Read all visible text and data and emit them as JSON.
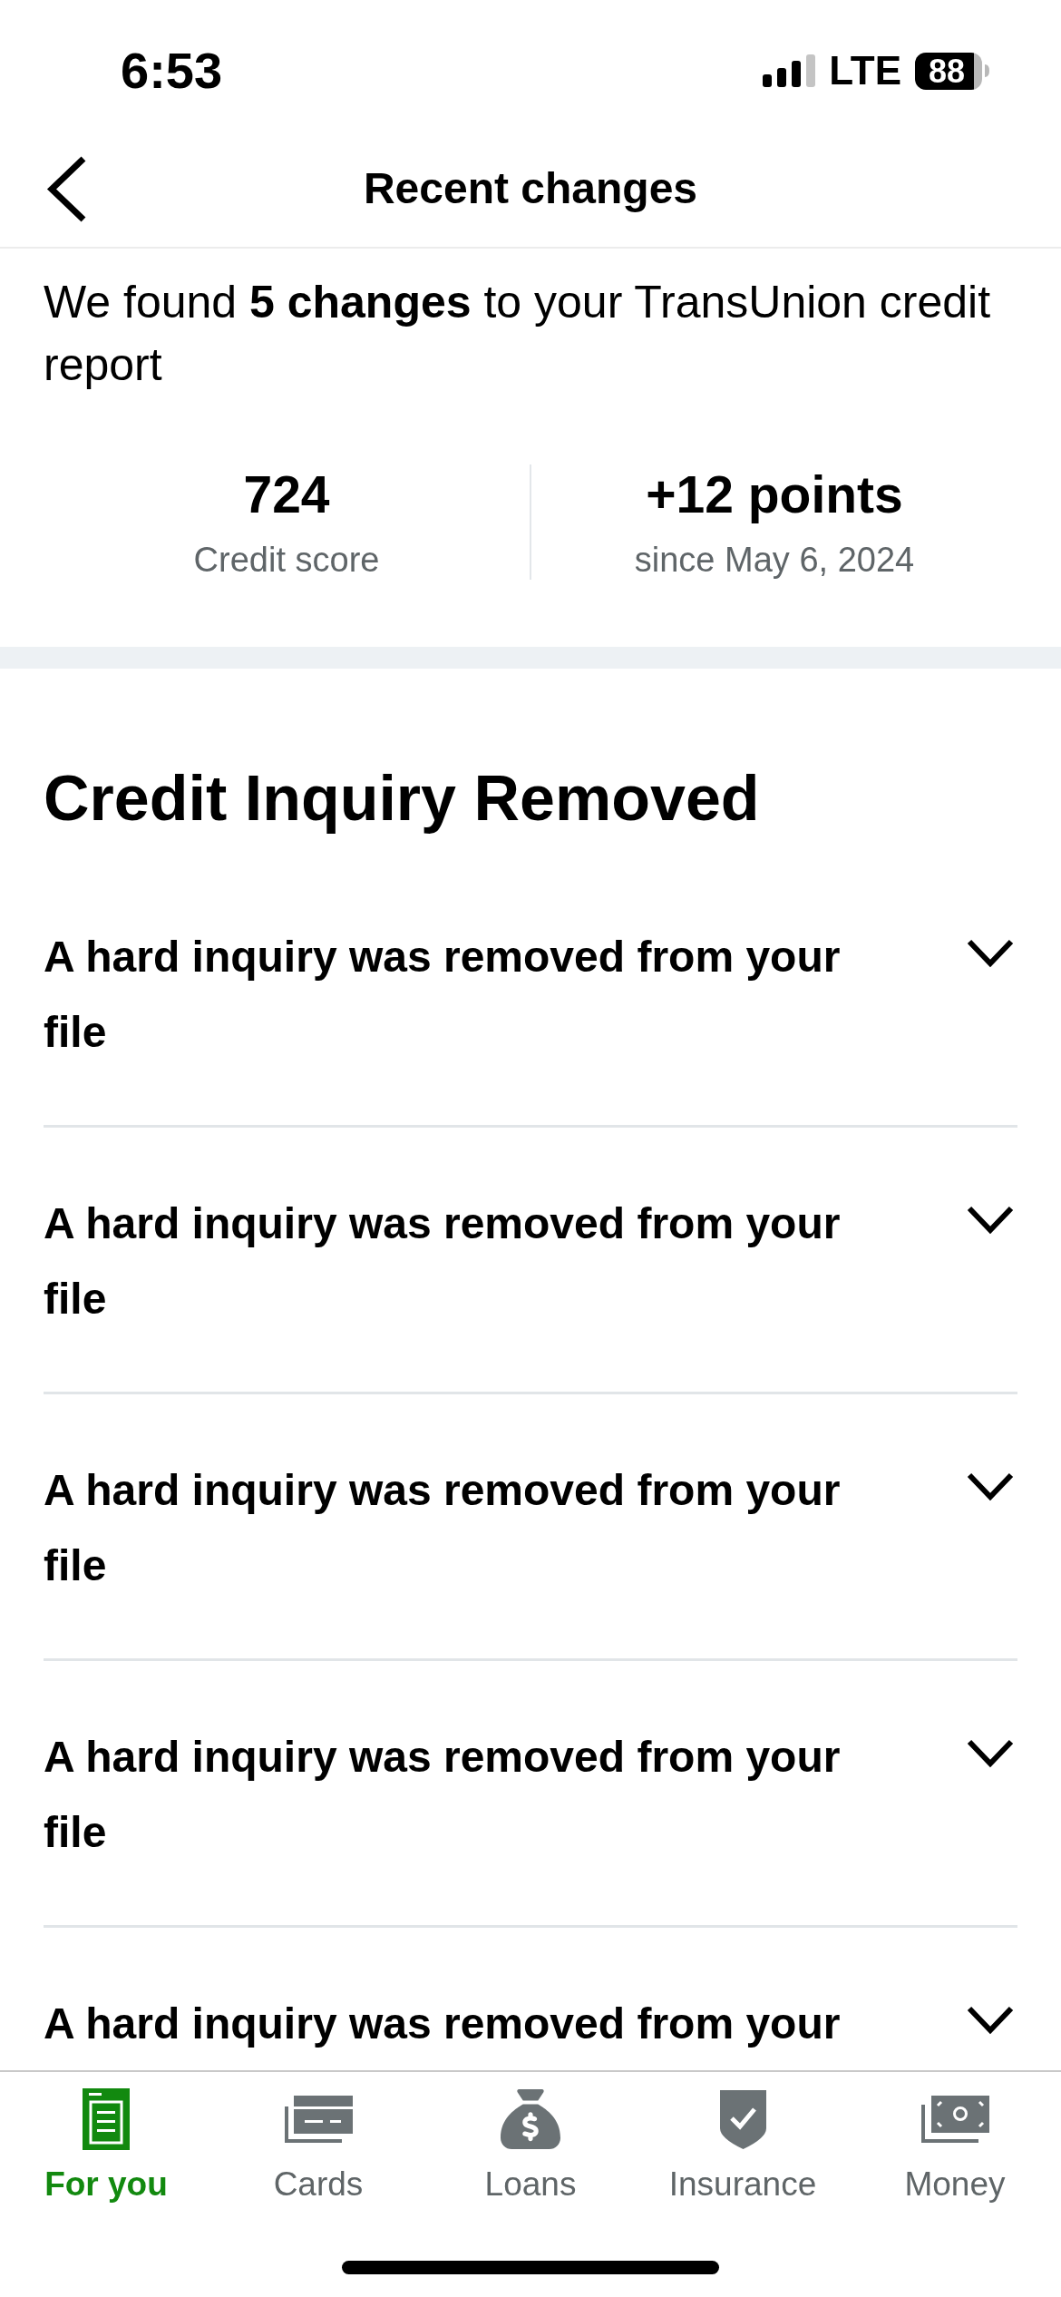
{
  "status_bar": {
    "time": "6:53",
    "network": "LTE",
    "battery": "88"
  },
  "header": {
    "title": "Recent changes"
  },
  "summary": {
    "text": "We found **5 changes** to your TransUnion credit report",
    "stats": [
      {
        "value": "724",
        "label": "Credit score"
      },
      {
        "value": "+12 points",
        "label": "since May 6, 2024"
      }
    ]
  },
  "section": {
    "title": "Credit Inquiry Removed",
    "items": [
      {
        "title": "A hard inquiry was removed from your file",
        "expanded": false
      },
      {
        "title": "A hard inquiry was removed from your file",
        "expanded": false
      },
      {
        "title": "A hard inquiry was removed from your file",
        "expanded": false
      },
      {
        "title": "A hard inquiry was removed from your file",
        "expanded": false
      },
      {
        "title": "A hard inquiry was removed from your",
        "expanded": false
      }
    ]
  },
  "tab_bar": {
    "tabs": [
      {
        "label": "For you",
        "selected": true
      },
      {
        "label": "Cards",
        "selected": false
      },
      {
        "label": "Loans",
        "selected": false
      },
      {
        "label": "Insurance",
        "selected": false
      },
      {
        "label": "Money",
        "selected": false
      }
    ]
  }
}
